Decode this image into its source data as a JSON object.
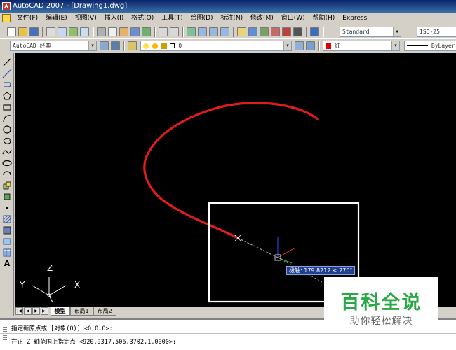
{
  "window": {
    "title": "AutoCAD 2007 - [Drawing1.dwg]"
  },
  "menu": {
    "items": [
      "文件(F)",
      "编辑(E)",
      "视图(V)",
      "插入(I)",
      "格式(O)",
      "工具(T)",
      "绘图(D)",
      "标注(N)",
      "修改(M)",
      "窗口(W)",
      "帮助(H)",
      "Express"
    ]
  },
  "toolbar": {
    "text_style": "Standard",
    "dim_style": "ISO-25",
    "workspace": "AutoCAD 经典",
    "layer": "0",
    "color": "红",
    "color_hex": "#e00000",
    "linetype": "ByLayer"
  },
  "canvas": {
    "tooltip": "极轴: 179.8212 < 270°",
    "ucs": {
      "x_label": "X",
      "y_label": "Y",
      "z_label": "Z"
    },
    "curve_color": "#e21b1b",
    "selection_color": "#ffffff"
  },
  "layout_tabs": [
    "模型",
    "布局1",
    "布局2"
  ],
  "command_line": {
    "line1": "指定新原点或 [对象(O)] <0,0,0>:",
    "line2": "在正 Z 轴范围上指定点 <920.9317,506.3702,1.0000>:"
  },
  "watermark": {
    "title": "百科全说",
    "subtitle": "助你轻松解决"
  }
}
